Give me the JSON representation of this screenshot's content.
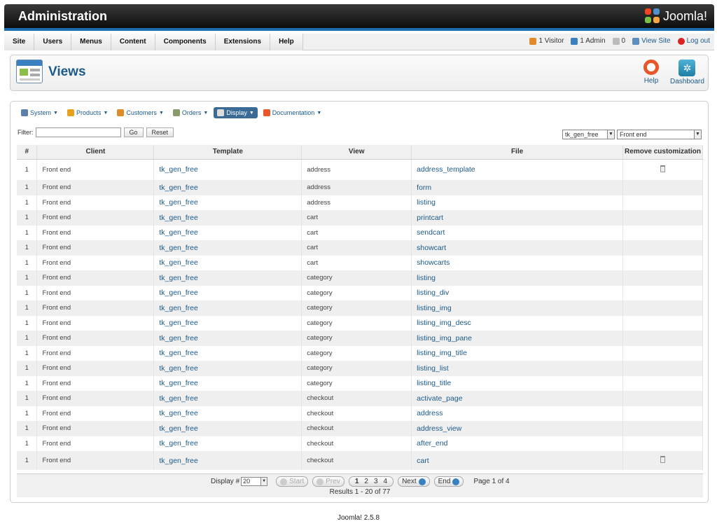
{
  "header": {
    "title": "Administration",
    "logo_text": "Joomla!"
  },
  "menubar": {
    "items": [
      "Site",
      "Users",
      "Menus",
      "Content",
      "Components",
      "Extensions",
      "Help"
    ],
    "status": {
      "visitors": "1 Visitor",
      "admins": "1 Admin",
      "messages": "0",
      "view_site": "View Site",
      "logout": "Log out"
    }
  },
  "toolbar": {
    "page_title": "Views",
    "help_label": "Help",
    "dashboard_label": "Dashboard"
  },
  "submenu": [
    {
      "label": "System",
      "icon": "tools-icon"
    },
    {
      "label": "Products",
      "icon": "products-icon"
    },
    {
      "label": "Customers",
      "icon": "customers-icon"
    },
    {
      "label": "Orders",
      "icon": "orders-icon"
    },
    {
      "label": "Display",
      "icon": "display-icon",
      "active": true
    },
    {
      "label": "Documentation",
      "icon": "lifebuoy-icon"
    }
  ],
  "filter": {
    "label": "Filter:",
    "value": "",
    "go_label": "Go",
    "reset_label": "Reset",
    "template_select": "tk_gen_free",
    "client_select": "Front end"
  },
  "table": {
    "columns": [
      "#",
      "Client",
      "Template",
      "View",
      "File",
      "Remove customization"
    ],
    "rows": [
      {
        "num": "1",
        "client": "Front end",
        "template": "tk_gen_free",
        "view": "address",
        "file": "address_template",
        "removable": true
      },
      {
        "num": "1",
        "client": "Front end",
        "template": "tk_gen_free",
        "view": "address",
        "file": "form"
      },
      {
        "num": "1",
        "client": "Front end",
        "template": "tk_gen_free",
        "view": "address",
        "file": "listing"
      },
      {
        "num": "1",
        "client": "Front end",
        "template": "tk_gen_free",
        "view": "cart",
        "file": "printcart"
      },
      {
        "num": "1",
        "client": "Front end",
        "template": "tk_gen_free",
        "view": "cart",
        "file": "sendcart"
      },
      {
        "num": "1",
        "client": "Front end",
        "template": "tk_gen_free",
        "view": "cart",
        "file": "showcart"
      },
      {
        "num": "1",
        "client": "Front end",
        "template": "tk_gen_free",
        "view": "cart",
        "file": "showcarts"
      },
      {
        "num": "1",
        "client": "Front end",
        "template": "tk_gen_free",
        "view": "category",
        "file": "listing"
      },
      {
        "num": "1",
        "client": "Front end",
        "template": "tk_gen_free",
        "view": "category",
        "file": "listing_div"
      },
      {
        "num": "1",
        "client": "Front end",
        "template": "tk_gen_free",
        "view": "category",
        "file": "listing_img"
      },
      {
        "num": "1",
        "client": "Front end",
        "template": "tk_gen_free",
        "view": "category",
        "file": "listing_img_desc"
      },
      {
        "num": "1",
        "client": "Front end",
        "template": "tk_gen_free",
        "view": "category",
        "file": "listing_img_pane"
      },
      {
        "num": "1",
        "client": "Front end",
        "template": "tk_gen_free",
        "view": "category",
        "file": "listing_img_title"
      },
      {
        "num": "1",
        "client": "Front end",
        "template": "tk_gen_free",
        "view": "category",
        "file": "listing_list"
      },
      {
        "num": "1",
        "client": "Front end",
        "template": "tk_gen_free",
        "view": "category",
        "file": "listing_title"
      },
      {
        "num": "1",
        "client": "Front end",
        "template": "tk_gen_free",
        "view": "checkout",
        "file": "activate_page"
      },
      {
        "num": "1",
        "client": "Front end",
        "template": "tk_gen_free",
        "view": "checkout",
        "file": "address"
      },
      {
        "num": "1",
        "client": "Front end",
        "template": "tk_gen_free",
        "view": "checkout",
        "file": "address_view"
      },
      {
        "num": "1",
        "client": "Front end",
        "template": "tk_gen_free",
        "view": "checkout",
        "file": "after_end"
      },
      {
        "num": "1",
        "client": "Front end",
        "template": "tk_gen_free",
        "view": "checkout",
        "file": "cart",
        "removable": true
      }
    ]
  },
  "pagination": {
    "display_label": "Display #",
    "display_value": "20",
    "start": "Start",
    "prev": "Prev",
    "pages": [
      "1",
      "2",
      "3",
      "4"
    ],
    "next": "Next",
    "end": "End",
    "page_info": "Page 1 of 4",
    "results": "Results 1 - 20 of 77"
  },
  "footer": "Joomla! 2.5.8",
  "colors": {
    "accent": "#1c6bb0",
    "link": "#1c5a8a",
    "header_bg": "#1a1a1a"
  }
}
